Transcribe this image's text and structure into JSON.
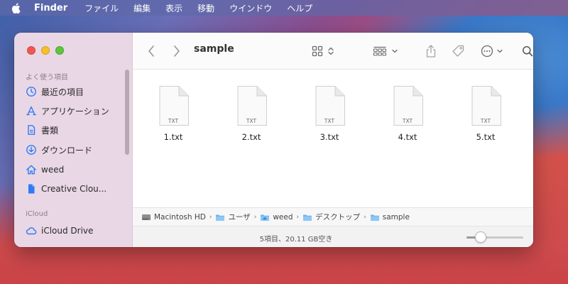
{
  "menubar": {
    "app": "Finder",
    "items": [
      "ファイル",
      "編集",
      "表示",
      "移動",
      "ウインドウ",
      "ヘルプ"
    ]
  },
  "window": {
    "title": "sample",
    "sidebar": {
      "favorites_title": "よく使う項目",
      "favorites": [
        {
          "label": "最近の項目",
          "icon": "clock-icon"
        },
        {
          "label": "アプリケーション",
          "icon": "apps-icon"
        },
        {
          "label": "書類",
          "icon": "document-icon"
        },
        {
          "label": "ダウンロード",
          "icon": "download-icon"
        },
        {
          "label": "weed",
          "icon": "home-icon"
        },
        {
          "label": "Creative Clou...",
          "icon": "creative-cloud-file-icon"
        }
      ],
      "icloud_title": "iCloud",
      "icloud": [
        {
          "label": "iCloud Drive",
          "icon": "cloud-icon"
        }
      ]
    },
    "files": [
      {
        "name": "1.txt",
        "badge": "TXT"
      },
      {
        "name": "2.txt",
        "badge": "TXT"
      },
      {
        "name": "3.txt",
        "badge": "TXT"
      },
      {
        "name": "4.txt",
        "badge": "TXT"
      },
      {
        "name": "5.txt",
        "badge": "TXT"
      }
    ],
    "path": [
      {
        "label": "Macintosh HD",
        "icon": "hard-drive-icon"
      },
      {
        "label": "ユーザ",
        "icon": "folder-icon"
      },
      {
        "label": "weed",
        "icon": "home-folder-icon"
      },
      {
        "label": "デスクトップ",
        "icon": "folder-icon"
      },
      {
        "label": "sample",
        "icon": "folder-icon"
      }
    ],
    "path_separator": "›",
    "status": "5項目、20.11 GB空き",
    "icon_size_slider": 0.25
  },
  "colors": {
    "accent": "#2f7bf6",
    "folder": "#6eb5f0"
  }
}
